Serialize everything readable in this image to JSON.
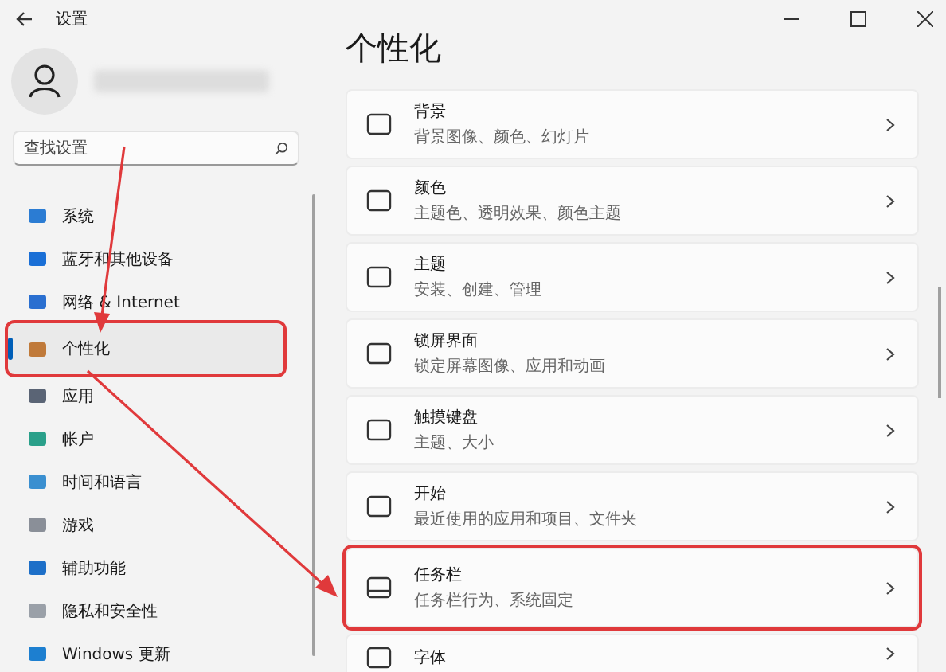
{
  "window": {
    "title": "设置"
  },
  "search": {
    "placeholder": "查找设置"
  },
  "sidebar": {
    "items": [
      {
        "label": "系统",
        "selected": false,
        "annotated": false
      },
      {
        "label": "蓝牙和其他设备",
        "selected": false,
        "annotated": false
      },
      {
        "label": "网络 & Internet",
        "selected": false,
        "annotated": false
      },
      {
        "label": "个性化",
        "selected": true,
        "annotated": true
      },
      {
        "label": "应用",
        "selected": false,
        "annotated": false
      },
      {
        "label": "帐户",
        "selected": false,
        "annotated": false
      },
      {
        "label": "时间和语言",
        "selected": false,
        "annotated": false
      },
      {
        "label": "游戏",
        "selected": false,
        "annotated": false
      },
      {
        "label": "辅助功能",
        "selected": false,
        "annotated": false
      },
      {
        "label": "隐私和安全性",
        "selected": false,
        "annotated": false
      },
      {
        "label": "Windows 更新",
        "selected": false,
        "annotated": false
      }
    ]
  },
  "page": {
    "title": "个性化",
    "cards": [
      {
        "title": "背景",
        "subtitle": "背景图像、颜色、幻灯片",
        "annotated": false
      },
      {
        "title": "颜色",
        "subtitle": "主题色、透明效果、颜色主题",
        "annotated": false
      },
      {
        "title": "主题",
        "subtitle": "安装、创建、管理",
        "annotated": false
      },
      {
        "title": "锁屏界面",
        "subtitle": "锁定屏幕图像、应用和动画",
        "annotated": false
      },
      {
        "title": "触摸键盘",
        "subtitle": "主题、大小",
        "annotated": false
      },
      {
        "title": "开始",
        "subtitle": "最近使用的应用和项目、文件夹",
        "annotated": false
      },
      {
        "title": "任务栏",
        "subtitle": "任务栏行为、系统固定",
        "annotated": true
      },
      {
        "title": "字体",
        "annotated": false
      }
    ]
  }
}
